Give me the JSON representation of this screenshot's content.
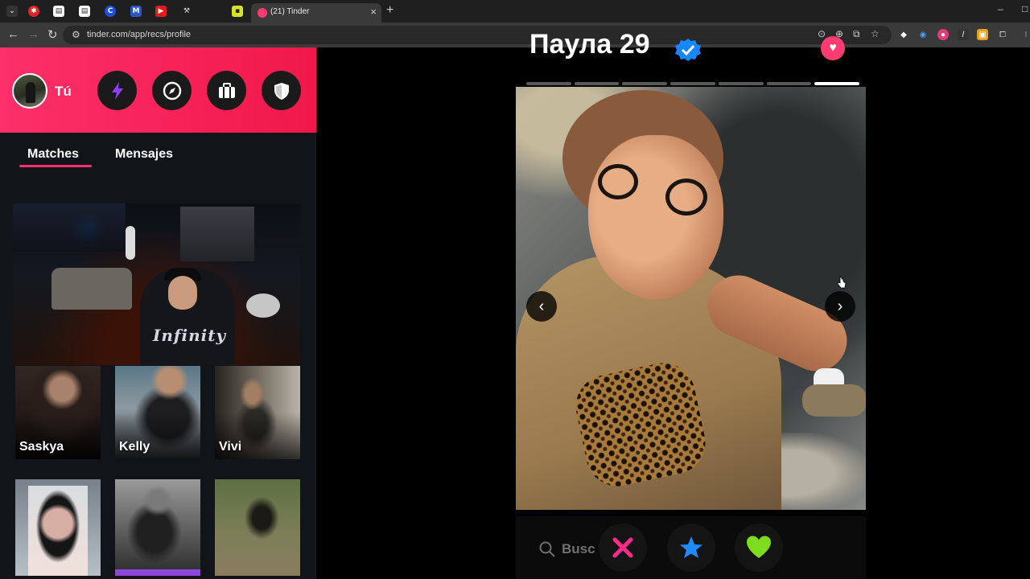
{
  "browser": {
    "tab": {
      "title": "(21) Tinder",
      "close_glyph": "×"
    },
    "new_tab_glyph": "+",
    "window_controls": {
      "minimize": "–",
      "restore": "□"
    },
    "url": "tinder.com/app/recs/profile",
    "nav": {
      "back": "←",
      "forward": "→",
      "reload": "↻"
    },
    "url_actions": {
      "location": "⊙",
      "zoom": "⊕",
      "install": "⧉",
      "bookmark": "☆"
    },
    "extensions_count_icons": [
      "ext-diamond-icon",
      "ext-audio-icon",
      "ext-pink-icon",
      "ext-slash-icon",
      "ext-lock-icon",
      "ext-puzzle-icon"
    ]
  },
  "sidebar": {
    "user_label": "Tú",
    "header_buttons": [
      "boost-icon",
      "explore-icon",
      "briefcase-icon",
      "shield-icon"
    ],
    "tabs": [
      {
        "label": "Matches",
        "active": true
      },
      {
        "label": "Mensajes",
        "active": false
      }
    ],
    "matches": [
      {
        "name": "Saskya"
      },
      {
        "name": "Kelly"
      },
      {
        "name": "Vivi"
      },
      {
        "name": ""
      },
      {
        "name": ""
      },
      {
        "name": ""
      }
    ],
    "big_card_text": "Infinity"
  },
  "profile": {
    "name_age": "Паула 29",
    "photo_count": 7,
    "current_photo": 7,
    "prev_glyph": "‹",
    "next_glyph": "›"
  },
  "actions": {
    "search_hint": "Busc",
    "buttons": [
      "nope-icon",
      "super-like-icon",
      "like-icon"
    ]
  },
  "colors": {
    "brand_pink": "#fd2f6a",
    "nope": "#fe2b8a",
    "super_like": "#1e8cff",
    "like": "#7ddc1e"
  }
}
